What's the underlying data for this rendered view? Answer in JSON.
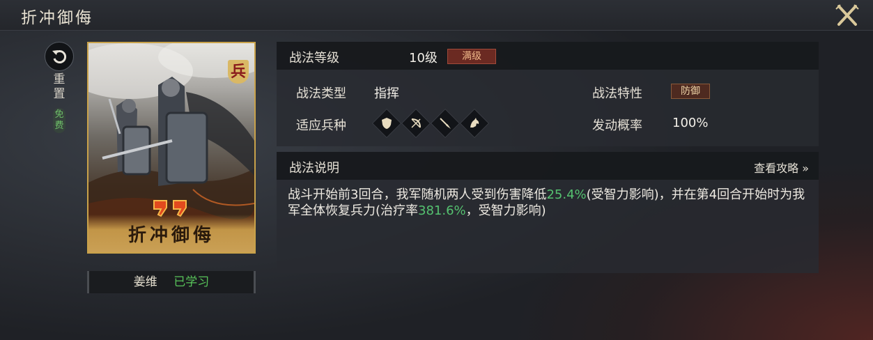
{
  "header": {
    "title": "折冲御侮"
  },
  "sidebar": {
    "reset_label": "重置",
    "free_label": "免费"
  },
  "card": {
    "type_char": "兵",
    "name": "折冲御侮"
  },
  "owner": {
    "name": "姜维",
    "status": "已学习"
  },
  "info": {
    "level_label": "战法等级",
    "level_value": "10级",
    "level_badge": "满级",
    "type_label": "战法类型",
    "type_value": "指挥",
    "trait_label": "战法特性",
    "trait_value": "防御",
    "troops_label": "适应兵种",
    "troops": [
      "shield-icon",
      "bow-icon",
      "spear-icon",
      "horse-icon"
    ],
    "chance_label": "发动概率",
    "chance_value": "100%"
  },
  "description": {
    "title": "战法说明",
    "guide_link": "查看攻略 »",
    "part1": "战斗开始前3回合，我军随机两人受到伤害降低",
    "value1": "25.4%",
    "part2": "(受智力影响)，并在第4回合开始时为我军全体恢复兵力(治疗率",
    "value2": "381.6%",
    "part3": "，受智力影响)"
  },
  "colors": {
    "accent_gold": "#c9a24a",
    "highlight_green": "#55c270",
    "learned_green": "#58c45a"
  }
}
